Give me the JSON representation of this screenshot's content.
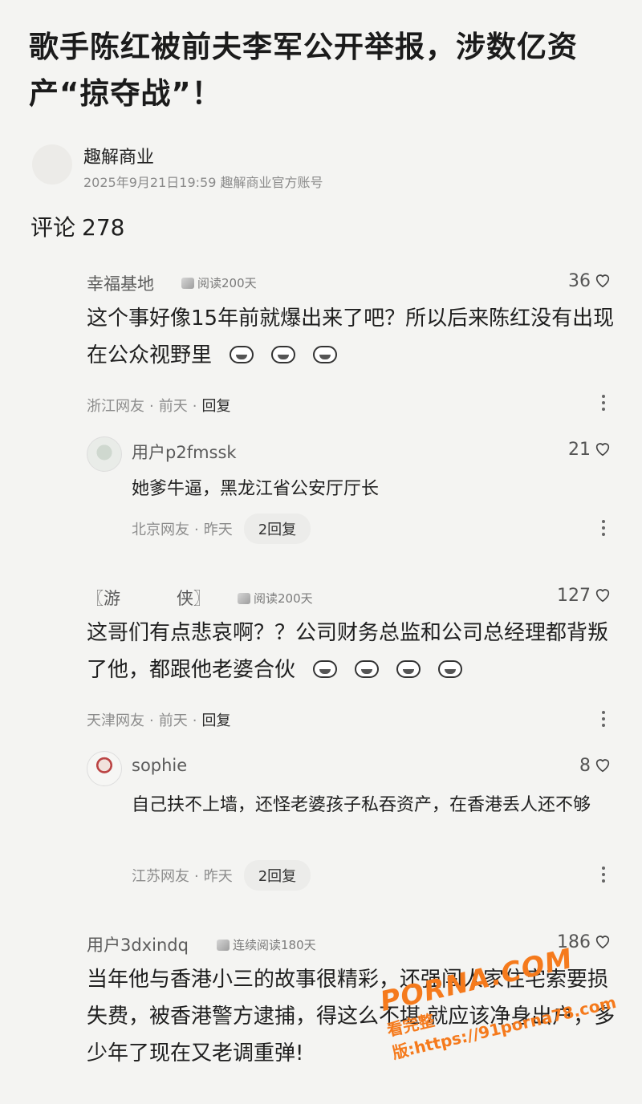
{
  "article": {
    "title": "歌手陈红被前夫李军公开举报，涉数亿资产“掠夺战”！",
    "author": "趣解商业",
    "meta": "2025年9月21日19:59 趣解商业官方账号"
  },
  "comments_header": {
    "label": "评论",
    "count": "278"
  },
  "comments": [
    {
      "name": "幸福基地",
      "badge": "阅读200天",
      "likes": "36",
      "text": "这个事好像15年前就爆出来了吧？所以后来陈红没有出现在公众视野里",
      "location": "浙江网友",
      "time": "前天",
      "reply": "回复",
      "sub": {
        "name": "用户p2fmssk",
        "likes": "21",
        "text": "她爹牛逼，黑龙江省公安厅厅长",
        "location": "北京网友",
        "time": "昨天",
        "replies": "2回复"
      }
    },
    {
      "name": "〖游",
      "name_tail": "侠〗",
      "badge": "阅读200天",
      "likes": "127",
      "text": "这哥们有点悲哀啊？？公司财务总监和公司总经理都背叛了他，都跟他老婆合伙",
      "location": "天津网友",
      "time": "前天",
      "reply": "回复",
      "sub": {
        "name": "sophie",
        "likes": "8",
        "text": "自己扶不上墙，还怪老婆孩子私吞资产，在香港丢人还不够",
        "location": "江苏网友",
        "time": "昨天",
        "replies": "2回复"
      }
    },
    {
      "name": "用户3dxindq",
      "badge": "连续阅读180天",
      "likes": "186",
      "text": "当年他与香港小三的故事很精彩，还强闯人家住宅索要损失费，被香港警方逮捕，得这么不堪 就应该净身出户，多少年了现在又老调重弹!"
    }
  ],
  "watermark": {
    "main": "PORNA.COM",
    "url": "https://91porna78.com",
    "prefix": "看完整版:"
  },
  "colors": {
    "background": "#f4f4f2",
    "watermark": "#f57a1c"
  }
}
